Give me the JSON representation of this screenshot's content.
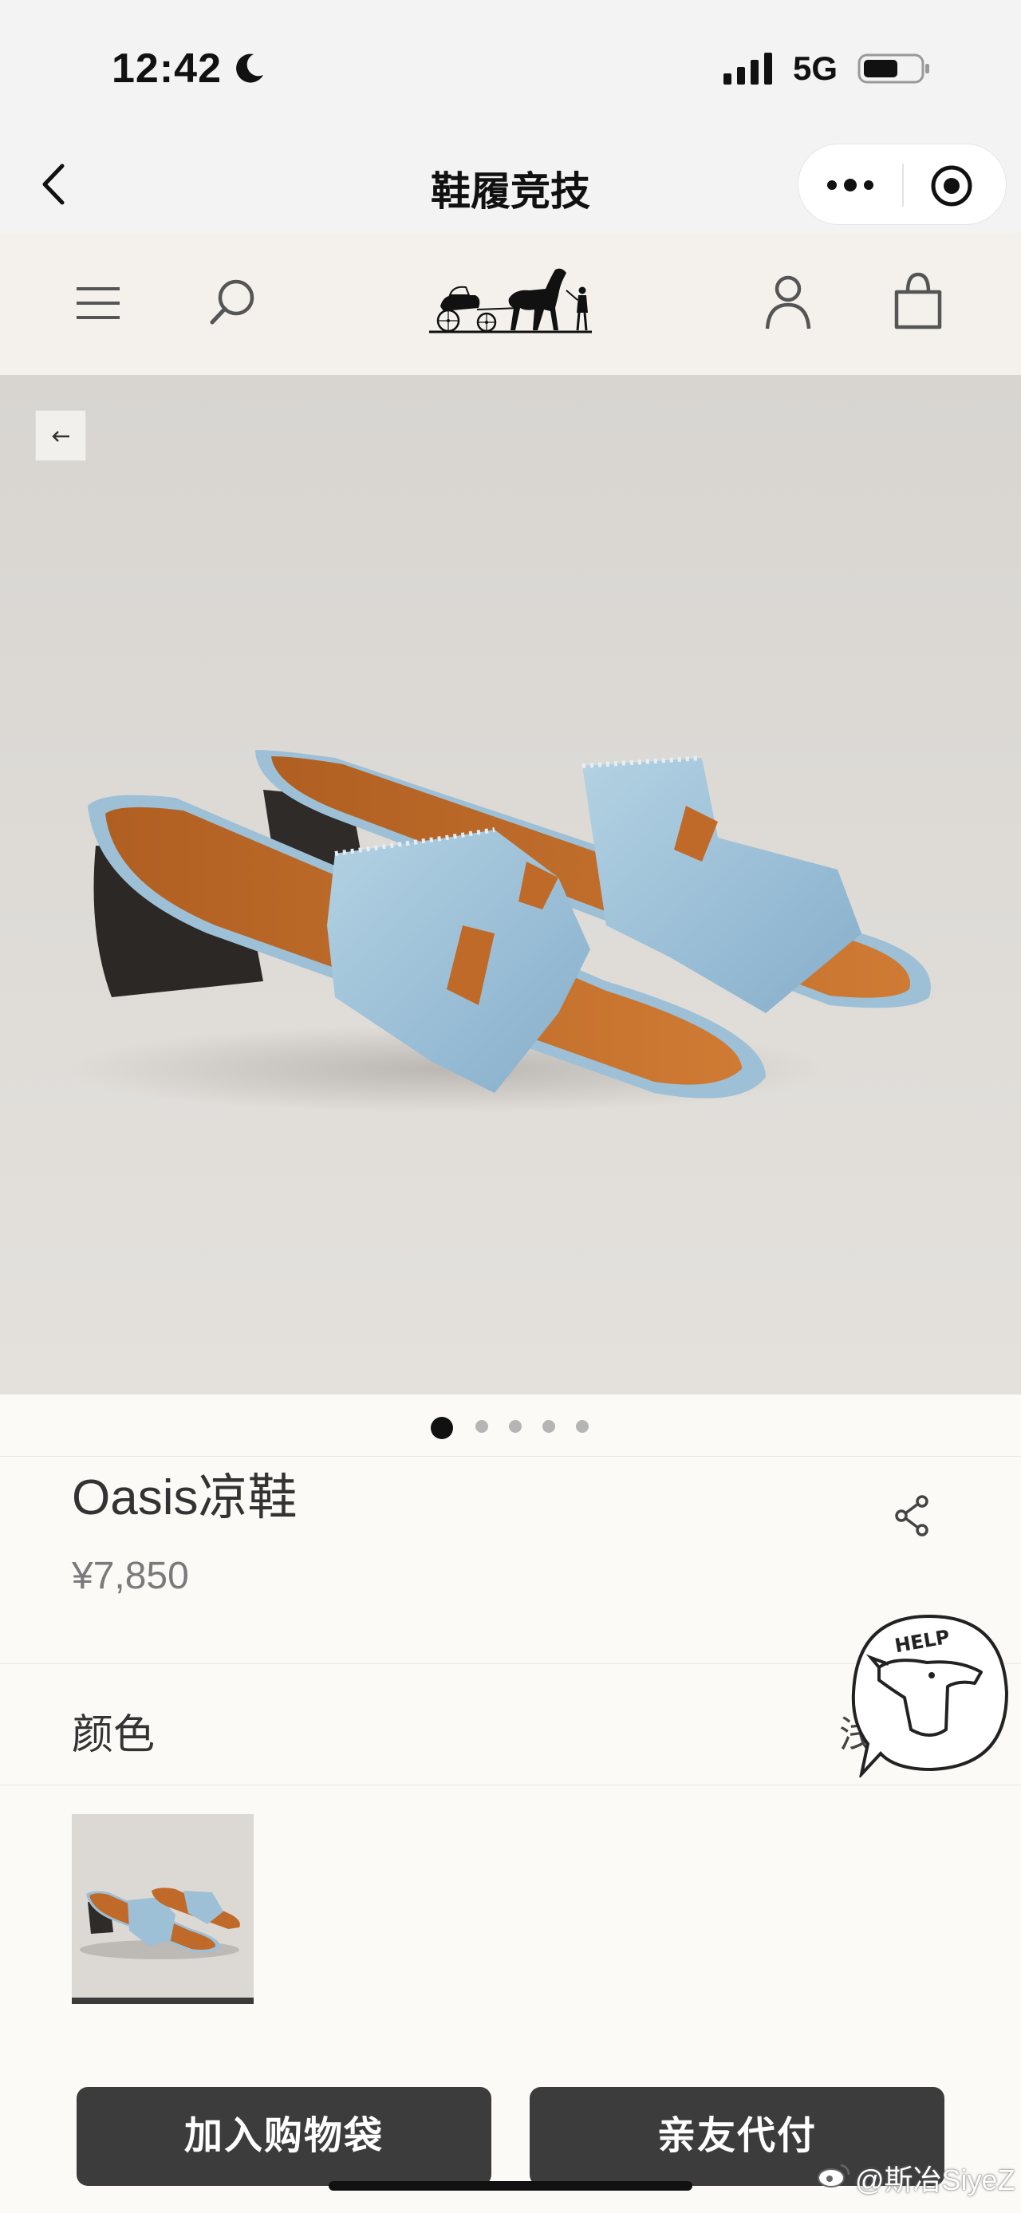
{
  "status_bar": {
    "time": "12:42",
    "network": "5G",
    "icons": [
      "moon-icon",
      "signal-icon",
      "battery-icon"
    ]
  },
  "nav": {
    "title": "鞋履竞技",
    "icons": [
      "back-icon",
      "more-icon",
      "record-icon"
    ]
  },
  "header": {
    "icons": [
      "menu-icon",
      "search-icon",
      "carriage-logo",
      "user-icon",
      "bag-icon"
    ]
  },
  "gallery": {
    "image_count": 5,
    "active_index": 0
  },
  "product": {
    "title": "Oasis凉鞋",
    "price": "¥7,850"
  },
  "color": {
    "label": "颜色",
    "value": "浅"
  },
  "help": {
    "text": "HELP"
  },
  "actions": {
    "add_to_bag": "加入购物袋",
    "friend_pay": "亲友代付"
  },
  "watermark": {
    "text": "@斯冶SiyeZ"
  },
  "colors": {
    "accent_button": "#3c3c3c",
    "denim": "#9fc3d8",
    "leather": "#c06a2a"
  }
}
